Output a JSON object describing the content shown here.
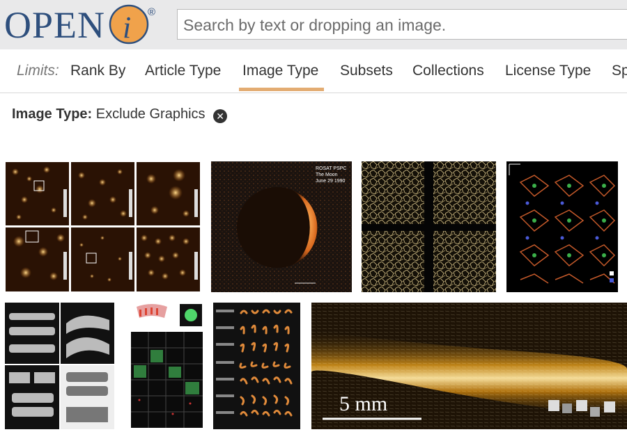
{
  "header": {
    "logo_text": "OPENi",
    "search_placeholder": "Search by text or dropping an image."
  },
  "limits_bar": {
    "label": "Limits:",
    "tabs": [
      "Rank By",
      "Article Type",
      "Image Type",
      "Subsets",
      "Collections",
      "License Type",
      "Sp"
    ],
    "active_tab": "Image Type"
  },
  "active_filter": {
    "name": "Image Type:",
    "value": "Exclude Graphics"
  },
  "results": {
    "thumbnails": [
      {
        "name": "thumb-afm-nanoparticles"
      },
      {
        "name": "thumb-rosat-moon",
        "caption": [
          "ROSAT PSPC",
          "The Moon",
          "June 29 1990"
        ]
      },
      {
        "name": "thumb-network-panels"
      },
      {
        "name": "thumb-crystal-structure"
      },
      {
        "name": "thumb-grayscale-segments"
      },
      {
        "name": "thumb-fluorescence-grid"
      },
      {
        "name": "thumb-shape-array"
      },
      {
        "name": "thumb-golden-fiber",
        "scale_label": "5 mm"
      }
    ]
  },
  "colors": {
    "header_bg": "#e9e9ea",
    "logo_blue": "#2e4f7d",
    "logo_orange": "#f0a24b",
    "active_underline": "#e3ac72"
  }
}
